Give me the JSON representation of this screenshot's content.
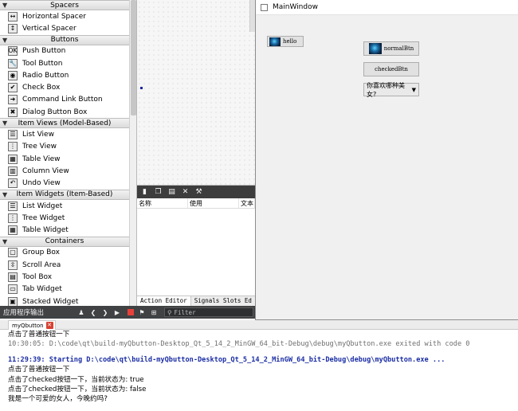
{
  "widget_box": {
    "categories": [
      {
        "label": "Spacers",
        "items": [
          {
            "label": "Horizontal Spacer",
            "icon": "horizontal-spacer-icon",
            "glyph": "↔"
          },
          {
            "label": "Vertical Spacer",
            "icon": "vertical-spacer-icon",
            "glyph": "↕"
          }
        ]
      },
      {
        "label": "Buttons",
        "items": [
          {
            "label": "Push Button",
            "icon": "push-button-icon",
            "glyph": "OK"
          },
          {
            "label": "Tool Button",
            "icon": "tool-button-icon",
            "glyph": "🔧"
          },
          {
            "label": "Radio Button",
            "icon": "radio-button-icon",
            "glyph": "◉"
          },
          {
            "label": "Check Box",
            "icon": "check-box-icon",
            "glyph": "✔"
          },
          {
            "label": "Command Link Button",
            "icon": "command-link-icon",
            "glyph": "➜"
          },
          {
            "label": "Dialog Button Box",
            "icon": "dialog-button-box-icon",
            "glyph": "✖"
          }
        ]
      },
      {
        "label": "Item Views (Model-Based)",
        "items": [
          {
            "label": "List View",
            "icon": "list-view-icon",
            "glyph": "☰"
          },
          {
            "label": "Tree View",
            "icon": "tree-view-icon",
            "glyph": "⋮"
          },
          {
            "label": "Table View",
            "icon": "table-view-icon",
            "glyph": "▦"
          },
          {
            "label": "Column View",
            "icon": "column-view-icon",
            "glyph": "▥"
          },
          {
            "label": "Undo View",
            "icon": "undo-view-icon",
            "glyph": "↶"
          }
        ]
      },
      {
        "label": "Item Widgets (Item-Based)",
        "items": [
          {
            "label": "List Widget",
            "icon": "list-widget-icon",
            "glyph": "☰"
          },
          {
            "label": "Tree Widget",
            "icon": "tree-widget-icon",
            "glyph": "⋮"
          },
          {
            "label": "Table Widget",
            "icon": "table-widget-icon",
            "glyph": "▦"
          }
        ]
      },
      {
        "label": "Containers",
        "items": [
          {
            "label": "Group Box",
            "icon": "group-box-icon",
            "glyph": "▢"
          },
          {
            "label": "Scroll Area",
            "icon": "scroll-area-icon",
            "glyph": "⇳"
          },
          {
            "label": "Tool Box",
            "icon": "tool-box-icon",
            "glyph": "▤"
          },
          {
            "label": "Tab Widget",
            "icon": "tab-widget-icon",
            "glyph": "▭"
          },
          {
            "label": "Stacked Widget",
            "icon": "stacked-widget-icon",
            "glyph": "▣"
          }
        ]
      }
    ]
  },
  "action_editor": {
    "columns": [
      "名称",
      "使用",
      "文本"
    ],
    "tabs": [
      "Action Editor",
      "Signals Slots Ed"
    ]
  },
  "main_window": {
    "title": "MainWindow",
    "hello_button": "hello",
    "normal_button": "normalBtn",
    "checked_button": "checkedBtn",
    "combo_value": "你喜欢哪种美女?"
  },
  "output_bar": {
    "label": "应用程序输出",
    "filter_placeholder": "Filter"
  },
  "output_tab": {
    "label": "myQbutton"
  },
  "output_lines": {
    "line1": "点击了普通按钮一下",
    "line2": "10:30:05: D:\\code\\qt\\build-myQbutton-Desktop_Qt_5_14_2_MinGW_64_bit-Debug\\debug\\myQbutton.exe exited with code 0",
    "line3": "11:29:39: Starting D:\\code\\qt\\build-myQbutton-Desktop_Qt_5_14_2_MinGW_64_bit-Debug\\debug\\myQbutton.exe ...",
    "line4": "点击了普通按钮一下",
    "line5": "点击了checked按钮一下，当前状态为:  true",
    "line6": "点击了checked按钮一下，当前状态为:  false",
    "line7": "我是一个可爱的女人，今晚约吗?"
  },
  "colors": {
    "output_blue": "#1b2ea4",
    "output_gray": "#6f6f6f",
    "dark_toolbar": "#404244"
  }
}
